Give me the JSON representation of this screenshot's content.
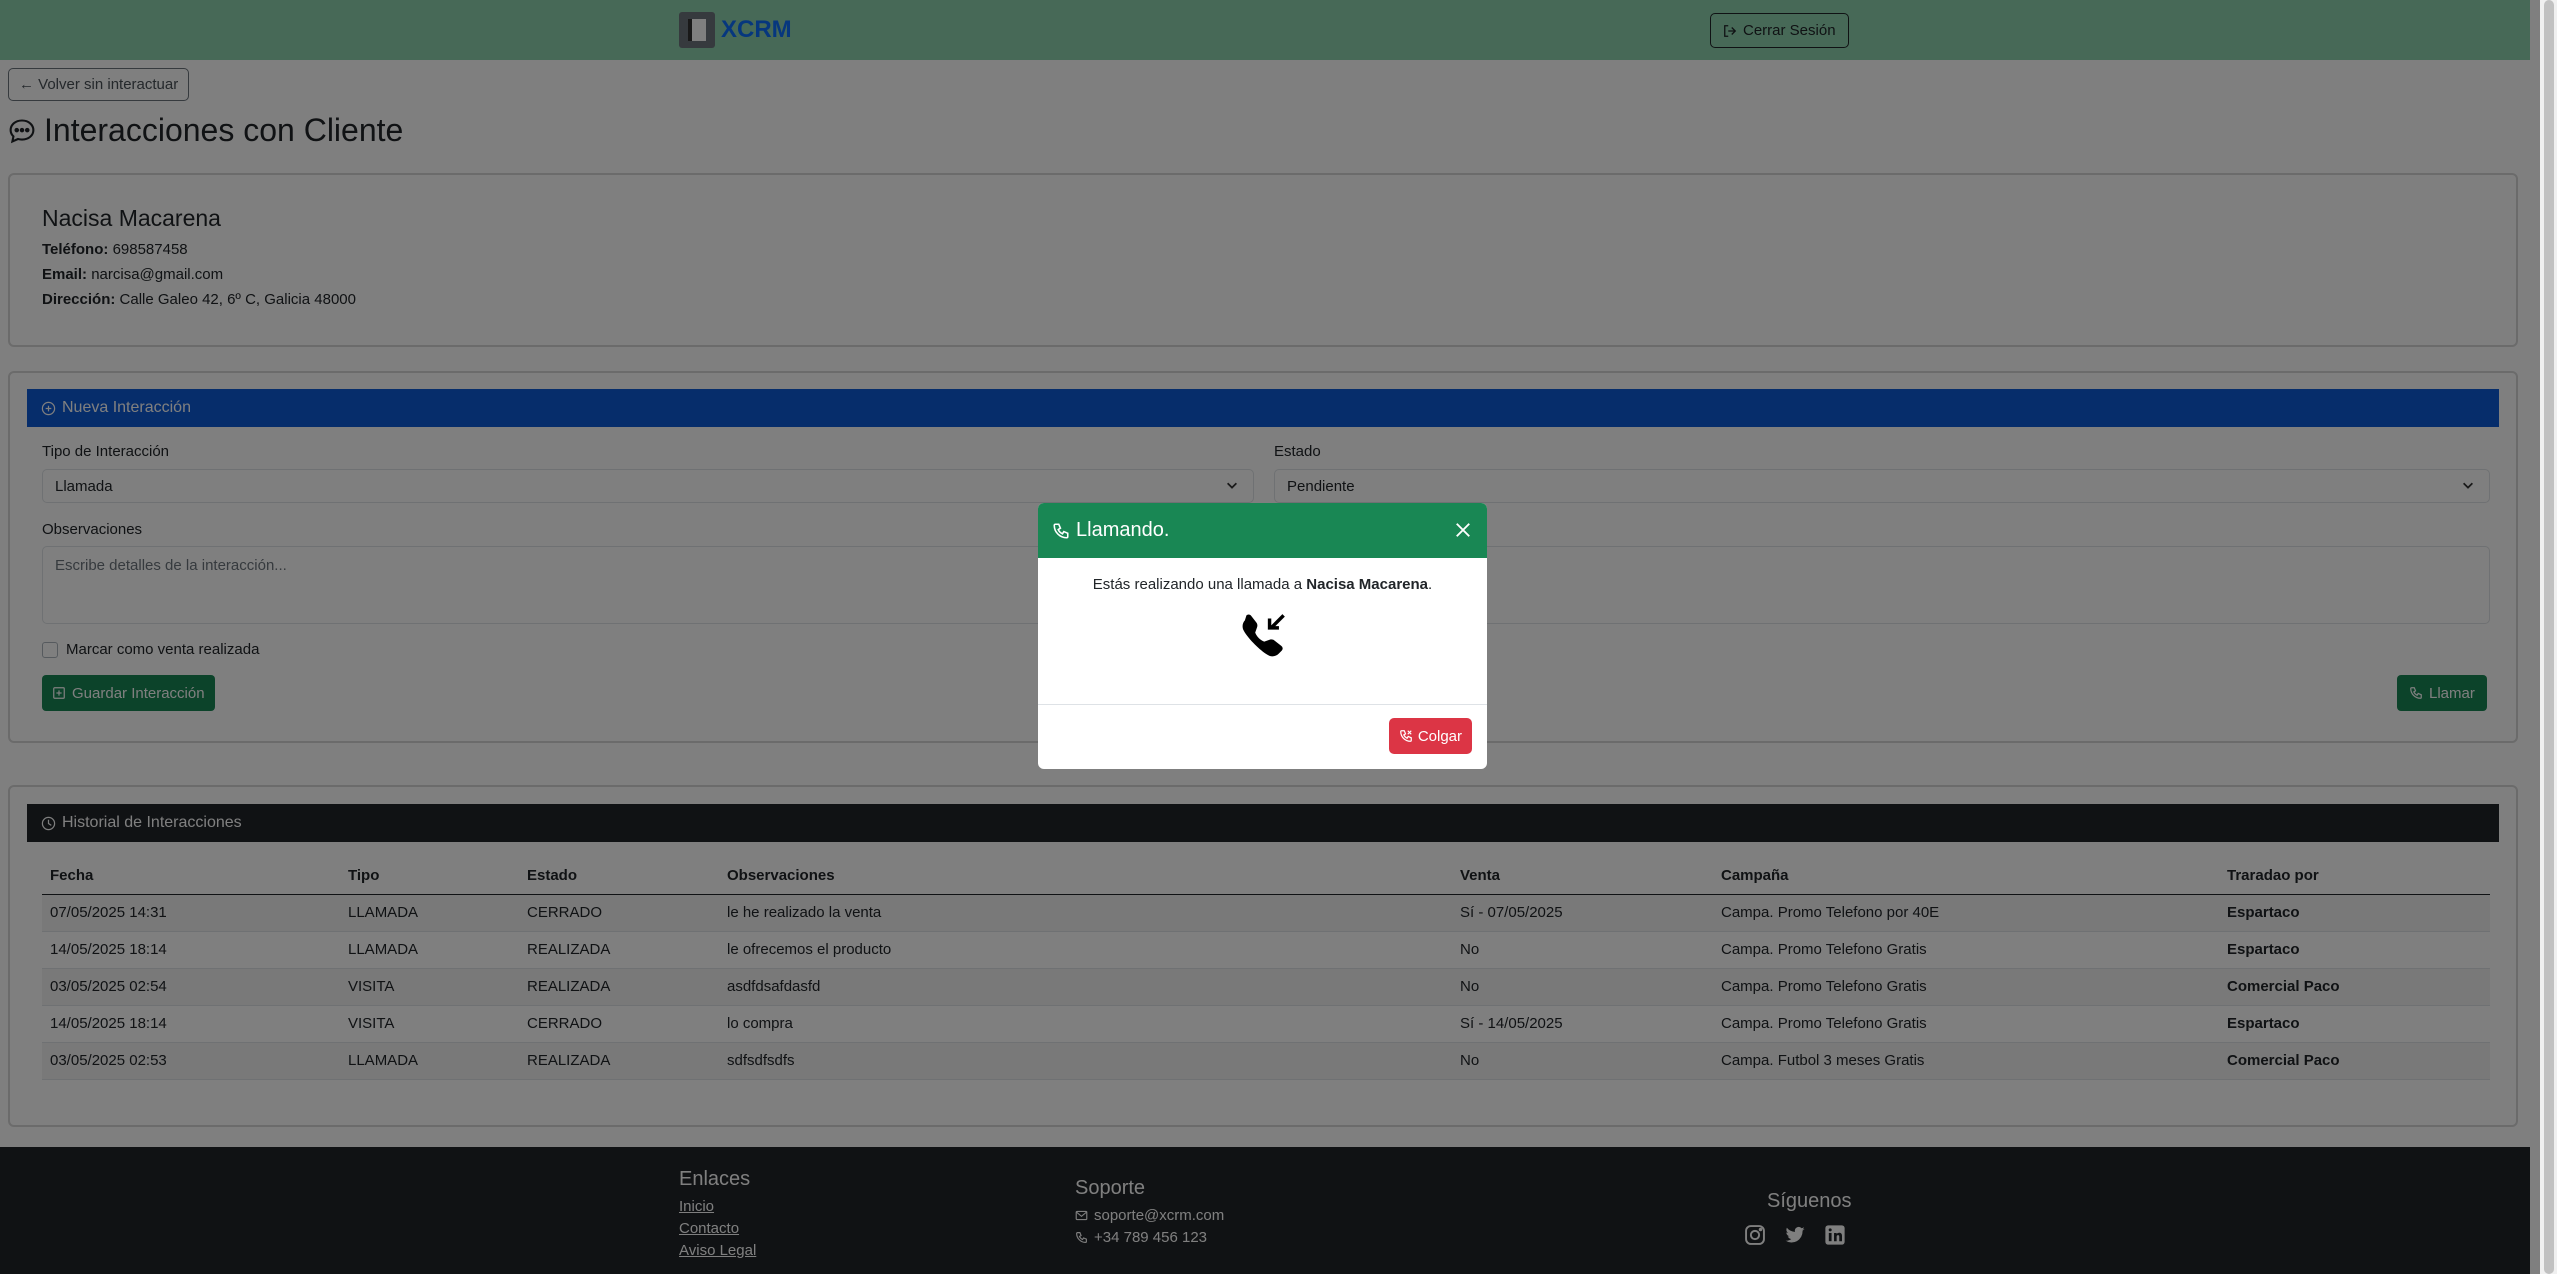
{
  "navbar": {
    "brand": "XCRM",
    "logout_label": "Cerrar Sesión"
  },
  "back_label": "← Volver sin interactuar",
  "page_title": "Interacciones con Cliente",
  "client": {
    "name": "Nacisa Macarena",
    "phone_label": "Teléfono:",
    "phone": "698587458",
    "email_label": "Email:",
    "email": "narcisa@gmail.com",
    "address_label": "Dirección:",
    "address": "Calle Galeo 42, 6º C, Galicia 48000"
  },
  "form": {
    "header": "Nueva Interacción",
    "type_label": "Tipo de Interacción",
    "type_value": "Llamada",
    "status_label": "Estado",
    "status_value": "Pendiente",
    "notes_label": "Observaciones",
    "notes_placeholder": "Escribe detalles de la interacción...",
    "sale_checkbox_label": "Marcar como venta realizada",
    "save_label": "Guardar Interacción",
    "call_label": "Llamar"
  },
  "history": {
    "header": "Historial de Interacciones",
    "columns": [
      "Fecha",
      "Tipo",
      "Estado",
      "Observaciones",
      "Venta",
      "Campaña",
      "Traradao por"
    ],
    "rows": [
      [
        "07/05/2025 14:31",
        "LLAMADA",
        "CERRADO",
        "le he realizado la venta",
        "Sí - 07/05/2025",
        "Campa. Promo Telefono por 40E",
        "Espartaco"
      ],
      [
        "14/05/2025 18:14",
        "LLAMADA",
        "REALIZADA",
        "le ofrecemos el producto",
        "No",
        "Campa. Promo Telefono Gratis",
        "Espartaco"
      ],
      [
        "03/05/2025 02:54",
        "VISITA",
        "REALIZADA",
        "asdfdsafdasfd",
        "No",
        "Campa. Promo Telefono Gratis",
        "Comercial Paco"
      ],
      [
        "14/05/2025 18:14",
        "VISITA",
        "CERRADO",
        "lo compra",
        "Sí - 14/05/2025",
        "Campa. Promo Telefono Gratis",
        "Espartaco"
      ],
      [
        "03/05/2025 02:53",
        "LLAMADA",
        "REALIZADA",
        "sdfsdfsdfs",
        "No",
        "Campa. Futbol 3 meses Gratis",
        "Comercial Paco"
      ]
    ]
  },
  "footer": {
    "links_title": "Enlaces",
    "links": [
      "Inicio",
      "Contacto",
      "Aviso Legal"
    ],
    "support_title": "Soporte",
    "support_email": "soporte@xcrm.com",
    "support_phone": "+34 789 456 123",
    "social_title": "Síguenos",
    "social_icons": [
      "instagram-icon",
      "twitter-icon",
      "linkedin-icon"
    ]
  },
  "modal": {
    "title": "Llamando.",
    "text_before": "Estás realizando una llamada a ",
    "client_name": "Nacisa Macarena",
    "text_after": ".",
    "hangup_label": "Colgar"
  },
  "colors": {
    "navbar": "#8fd3ae",
    "primary": "#0d5ad6",
    "success": "#198754",
    "danger": "#dc3545",
    "dark": "#212529"
  }
}
